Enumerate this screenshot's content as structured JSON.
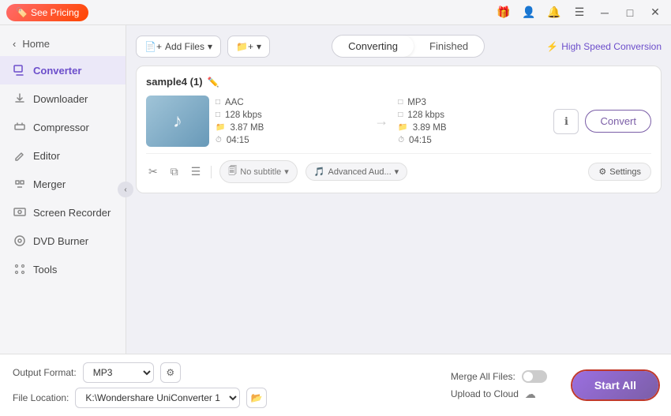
{
  "titlebar": {
    "pricing_label": "See Pricing",
    "controls": [
      "minimize",
      "maximize",
      "close"
    ]
  },
  "sidebar": {
    "home_label": "Home",
    "items": [
      {
        "id": "converter",
        "label": "Converter",
        "active": true
      },
      {
        "id": "downloader",
        "label": "Downloader",
        "active": false
      },
      {
        "id": "compressor",
        "label": "Compressor",
        "active": false
      },
      {
        "id": "editor",
        "label": "Editor",
        "active": false
      },
      {
        "id": "merger",
        "label": "Merger",
        "active": false
      },
      {
        "id": "screen-recorder",
        "label": "Screen Recorder",
        "active": false
      },
      {
        "id": "dvd-burner",
        "label": "DVD Burner",
        "active": false
      },
      {
        "id": "tools",
        "label": "Tools",
        "active": false
      }
    ]
  },
  "topbar": {
    "add_file_label": "Add Files",
    "add_folder_label": "Add Folder",
    "tabs": [
      {
        "id": "converting",
        "label": "Converting",
        "active": true
      },
      {
        "id": "finished",
        "label": "Finished",
        "active": false
      }
    ],
    "high_speed_label": "High Speed Conversion"
  },
  "file": {
    "name": "sample4 (1)",
    "source": {
      "format": "AAC",
      "bitrate": "128 kbps",
      "size": "3.87 MB",
      "duration": "04:15"
    },
    "target": {
      "format": "MP3",
      "bitrate": "128 kbps",
      "size": "3.89 MB",
      "duration": "04:15"
    },
    "subtitle_label": "No subtitle",
    "audio_label": "Advanced Aud...",
    "settings_label": "Settings",
    "convert_label": "Convert"
  },
  "bottombar": {
    "output_format_label": "Output Format:",
    "output_format_value": "MP3",
    "file_location_label": "File Location:",
    "file_location_value": "K:\\Wondershare UniConverter 1",
    "merge_label": "Merge All Files:",
    "upload_label": "Upload to Cloud",
    "start_all_label": "Start All"
  }
}
